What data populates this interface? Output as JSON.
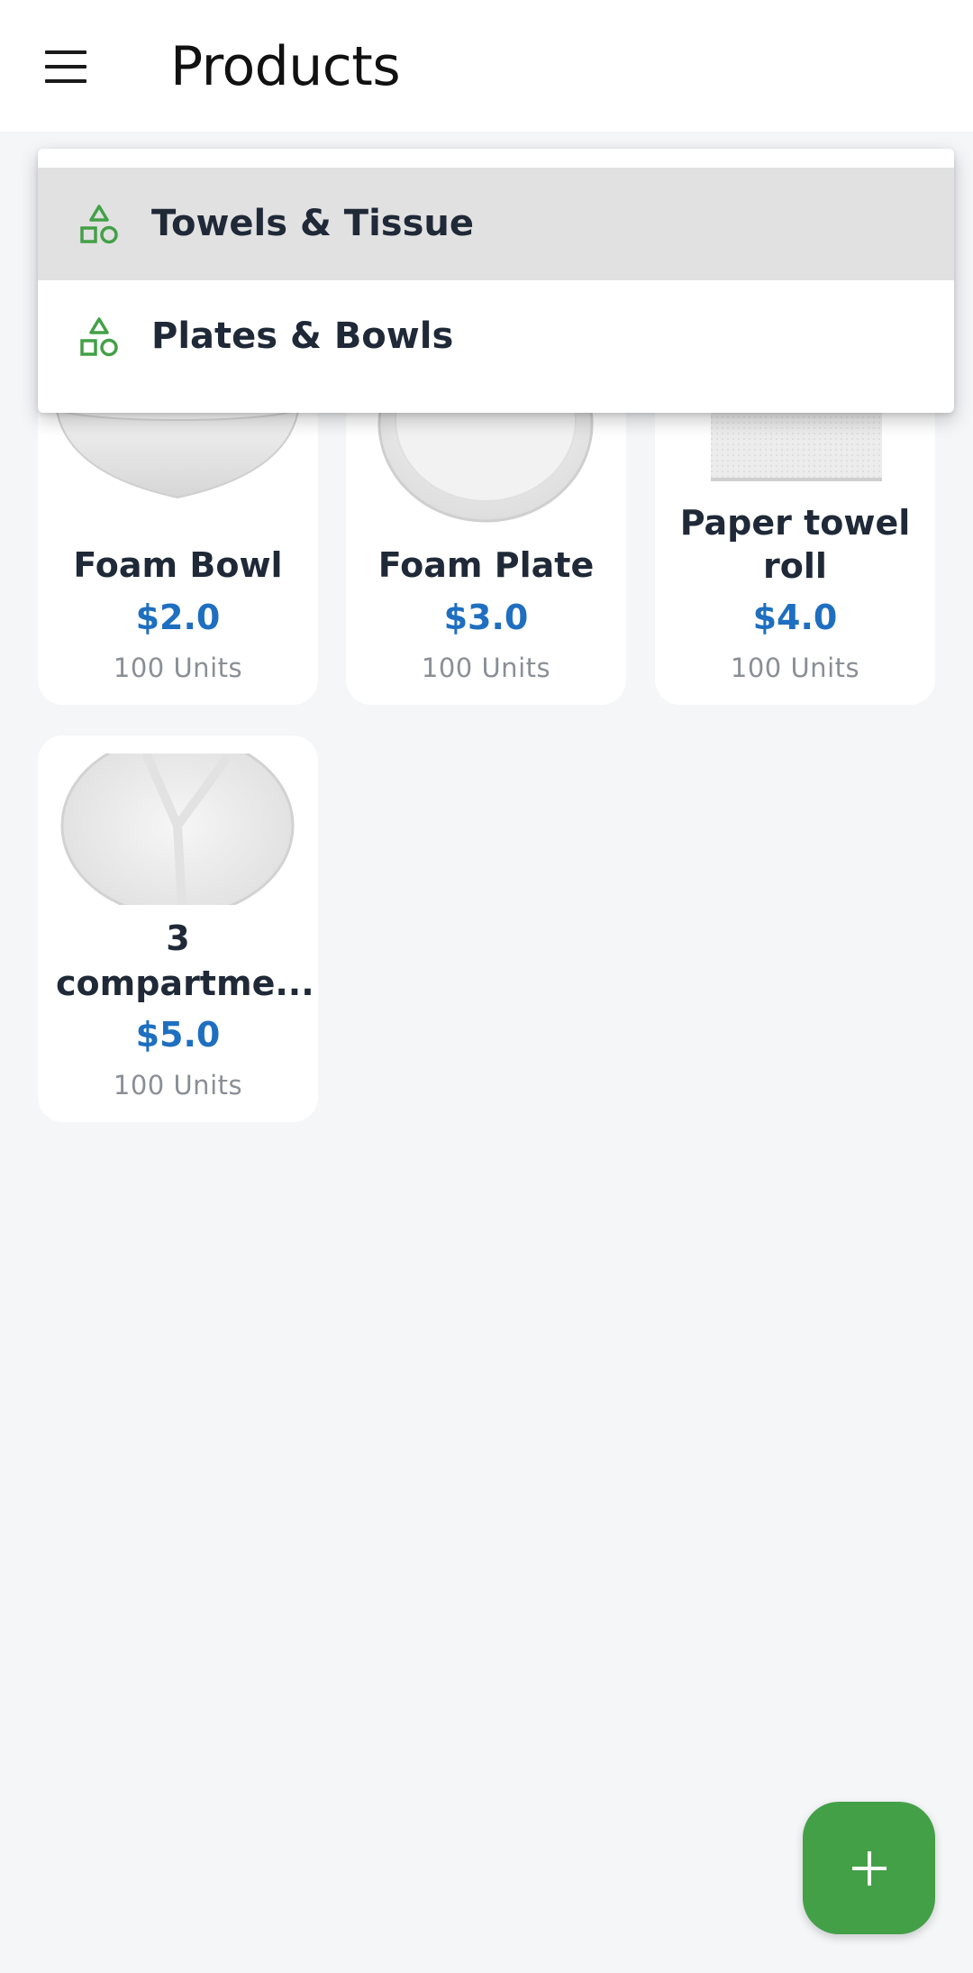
{
  "app_bar": {
    "title": "Products",
    "menu_icon": "hamburger-menu-icon"
  },
  "dropdown": {
    "items": [
      {
        "label": "Towels & Tissue",
        "icon": "category-shapes-icon",
        "selected": true
      },
      {
        "label": "Plates & Bowls",
        "icon": "category-shapes-icon",
        "selected": false
      }
    ]
  },
  "products": [
    {
      "name": "Foam Bowl",
      "price": "$2.0",
      "units": "100 Units"
    },
    {
      "name": "Foam Plate",
      "price": "$3.0",
      "units": "100 Units"
    },
    {
      "name": "Paper towel roll",
      "price": "$4.0",
      "units": "100 Units"
    },
    {
      "name": "3 compartme...",
      "price": "$5.0",
      "units": "100 Units"
    }
  ],
  "fab": {
    "icon": "plus-icon"
  },
  "colors": {
    "accent_green": "#43a047",
    "price_blue": "#1e6fc0",
    "selected_item_bg": "#e1e1e1",
    "page_bg": "#f5f6f8"
  }
}
